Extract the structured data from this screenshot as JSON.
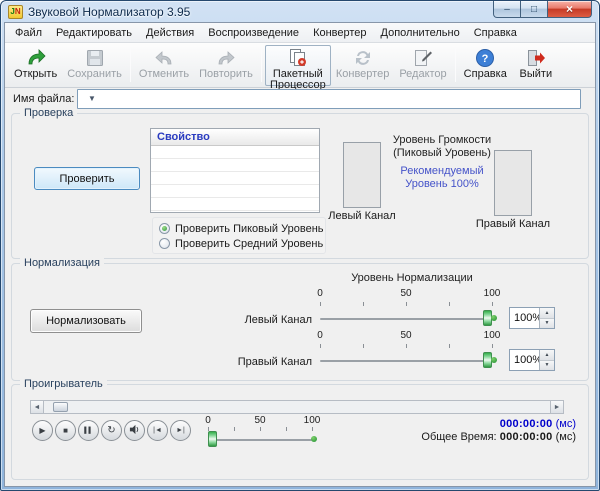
{
  "window": {
    "title": "Звуковой Нормализатор 3.95",
    "icon_text_j": "J",
    "icon_text_n": "N"
  },
  "icons": {
    "minimize": "–",
    "maximize": "□",
    "close": "×",
    "dropdown": "▼",
    "spin_up": "▲",
    "spin_down": "▼",
    "seek_left": "◄",
    "seek_right": "►"
  },
  "menu": {
    "items": [
      {
        "label": "Файл"
      },
      {
        "label": "Редактировать"
      },
      {
        "label": "Действия"
      },
      {
        "label": "Воспроизведение"
      },
      {
        "label": "Конвертер"
      },
      {
        "label": "Дополнительно"
      },
      {
        "label": "Справка"
      }
    ]
  },
  "toolbar": {
    "items": [
      {
        "label": "Открыть",
        "icon": "open-icon",
        "enabled": true
      },
      {
        "label": "Сохранить",
        "icon": "save-icon",
        "enabled": false
      },
      {
        "label": "Отменить",
        "icon": "undo-icon",
        "enabled": false
      },
      {
        "label": "Повторить",
        "icon": "redo-icon",
        "enabled": false
      },
      {
        "label": "Пакетный Процессор",
        "icon": "batch-processor-icon",
        "enabled": true
      },
      {
        "label": "Конвертер",
        "icon": "converter-icon",
        "enabled": false
      },
      {
        "label": "Редактор",
        "icon": "editor-icon",
        "enabled": false
      },
      {
        "label": "Справка",
        "icon": "help-icon",
        "enabled": true
      },
      {
        "label": "Выйти",
        "icon": "exit-icon",
        "enabled": true
      }
    ]
  },
  "file_row": {
    "label": "Имя файла:",
    "value": ""
  },
  "check": {
    "group_title": "Проверка",
    "check_button": "Проверить",
    "table": {
      "header": "Свойство",
      "rows": [
        "",
        "",
        "",
        "",
        ""
      ]
    },
    "volume_title": "Уровень Громкости (Пиковый Уровень)",
    "recommended": "Рекомендуемый Уровень 100%",
    "left_channel_label": "Левый Канал",
    "right_channel_label": "Правый Канал",
    "radio_peak": "Проверить Пиковый Уровень",
    "radio_average": "Проверить Средний Уровень",
    "selected_radio": "peak"
  },
  "normalization": {
    "group_title": "Нормализация",
    "normalize_button": "Нормализовать",
    "level_title": "Уровень Нормализации",
    "left": {
      "label": "Левый Канал",
      "ticks": [
        "0",
        "50",
        "100"
      ],
      "value": 100,
      "spin_value": "100%"
    },
    "right": {
      "label": "Правый Канал",
      "ticks": [
        "0",
        "50",
        "100"
      ],
      "value": 100,
      "spin_value": "100%"
    }
  },
  "player": {
    "group_title": "Проигрыватель",
    "buttons": [
      {
        "name": "play-button",
        "glyph": "▶"
      },
      {
        "name": "stop-button",
        "glyph": "■"
      },
      {
        "name": "pause-button",
        "glyph": "▌▌"
      },
      {
        "name": "loop-button",
        "glyph": "↻"
      },
      {
        "name": "volume-button",
        "icon": "speaker-icon"
      },
      {
        "name": "previous-button",
        "glyph": "|◄"
      },
      {
        "name": "next-button",
        "glyph": "►|"
      }
    ],
    "volume_ticks": [
      "0",
      "50",
      "100"
    ],
    "volume_value": 0,
    "current_time": "000:00:00",
    "current_time_unit": "(мс)",
    "total_time_label": "Общее Время:",
    "total_time": "000:00:00",
    "total_time_unit": "(мс)"
  },
  "colors": {
    "accent_blue": "#2a3bc0",
    "recommended_blue": "#4553c9",
    "time_blue": "#0000cc",
    "slider_green": "#2f9a42",
    "close_red": "#c63a26"
  }
}
